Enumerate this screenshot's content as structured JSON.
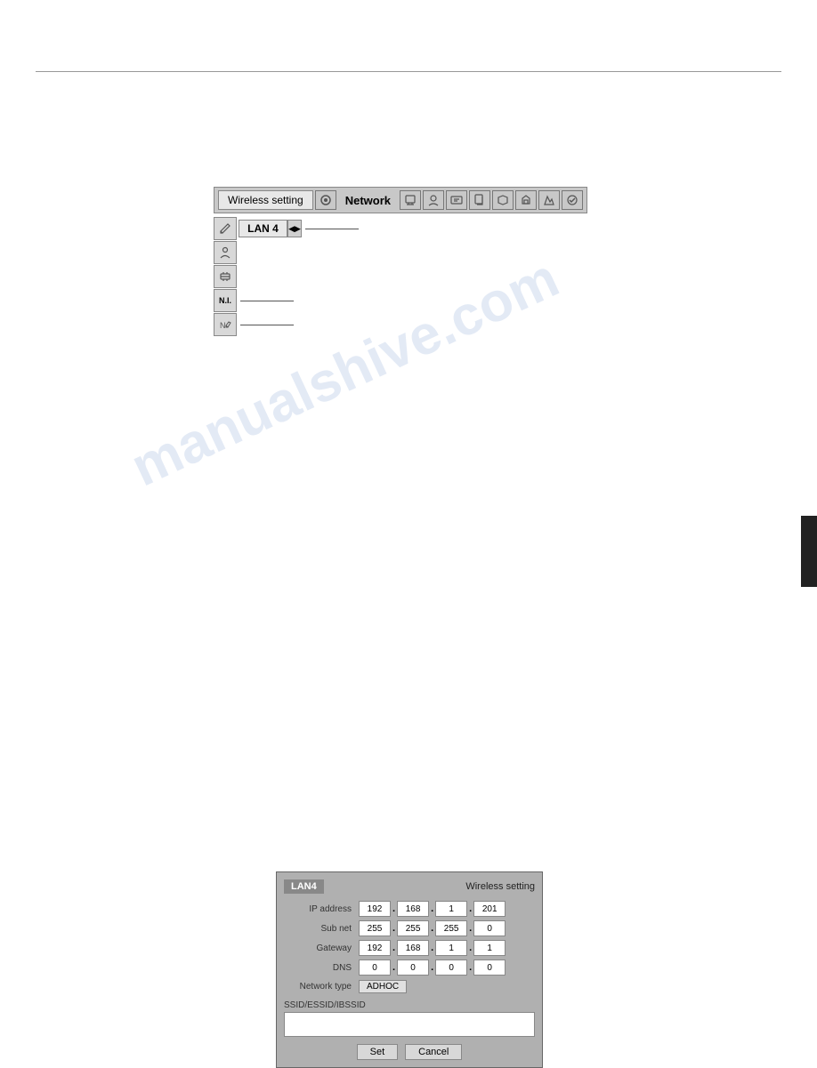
{
  "watermark": "manualshive.com",
  "topRule": true,
  "toolbar": {
    "wireless_btn": "Wireless setting",
    "network_label": "Network"
  },
  "sidebar": {
    "lan_label": "LAN 4",
    "items": [
      {
        "label": "✎",
        "type": "icon"
      },
      {
        "label": "👤",
        "type": "icon"
      },
      {
        "label": "✂",
        "type": "icon"
      },
      {
        "label": "N.I.",
        "type": "text"
      },
      {
        "label": "N✎",
        "type": "icon"
      }
    ]
  },
  "dialog": {
    "title_lan": "LAN4",
    "title_wireless": "Wireless setting",
    "fields": [
      {
        "label": "IP address",
        "values": [
          "192",
          "168",
          "1",
          "201"
        ]
      },
      {
        "label": "Sub net",
        "values": [
          "255",
          "255",
          "255",
          "0"
        ]
      },
      {
        "label": "Gateway",
        "values": [
          "192",
          "168",
          "1",
          "1"
        ]
      },
      {
        "label": "DNS",
        "values": [
          "0",
          "0",
          "0",
          "0"
        ]
      }
    ],
    "network_type_label": "Network type",
    "network_type_value": "ADHOC",
    "ssid_label": "SSID/ESSID/IBSSID",
    "ssid_value": "",
    "set_btn": "Set",
    "cancel_btn": "Cancel"
  }
}
